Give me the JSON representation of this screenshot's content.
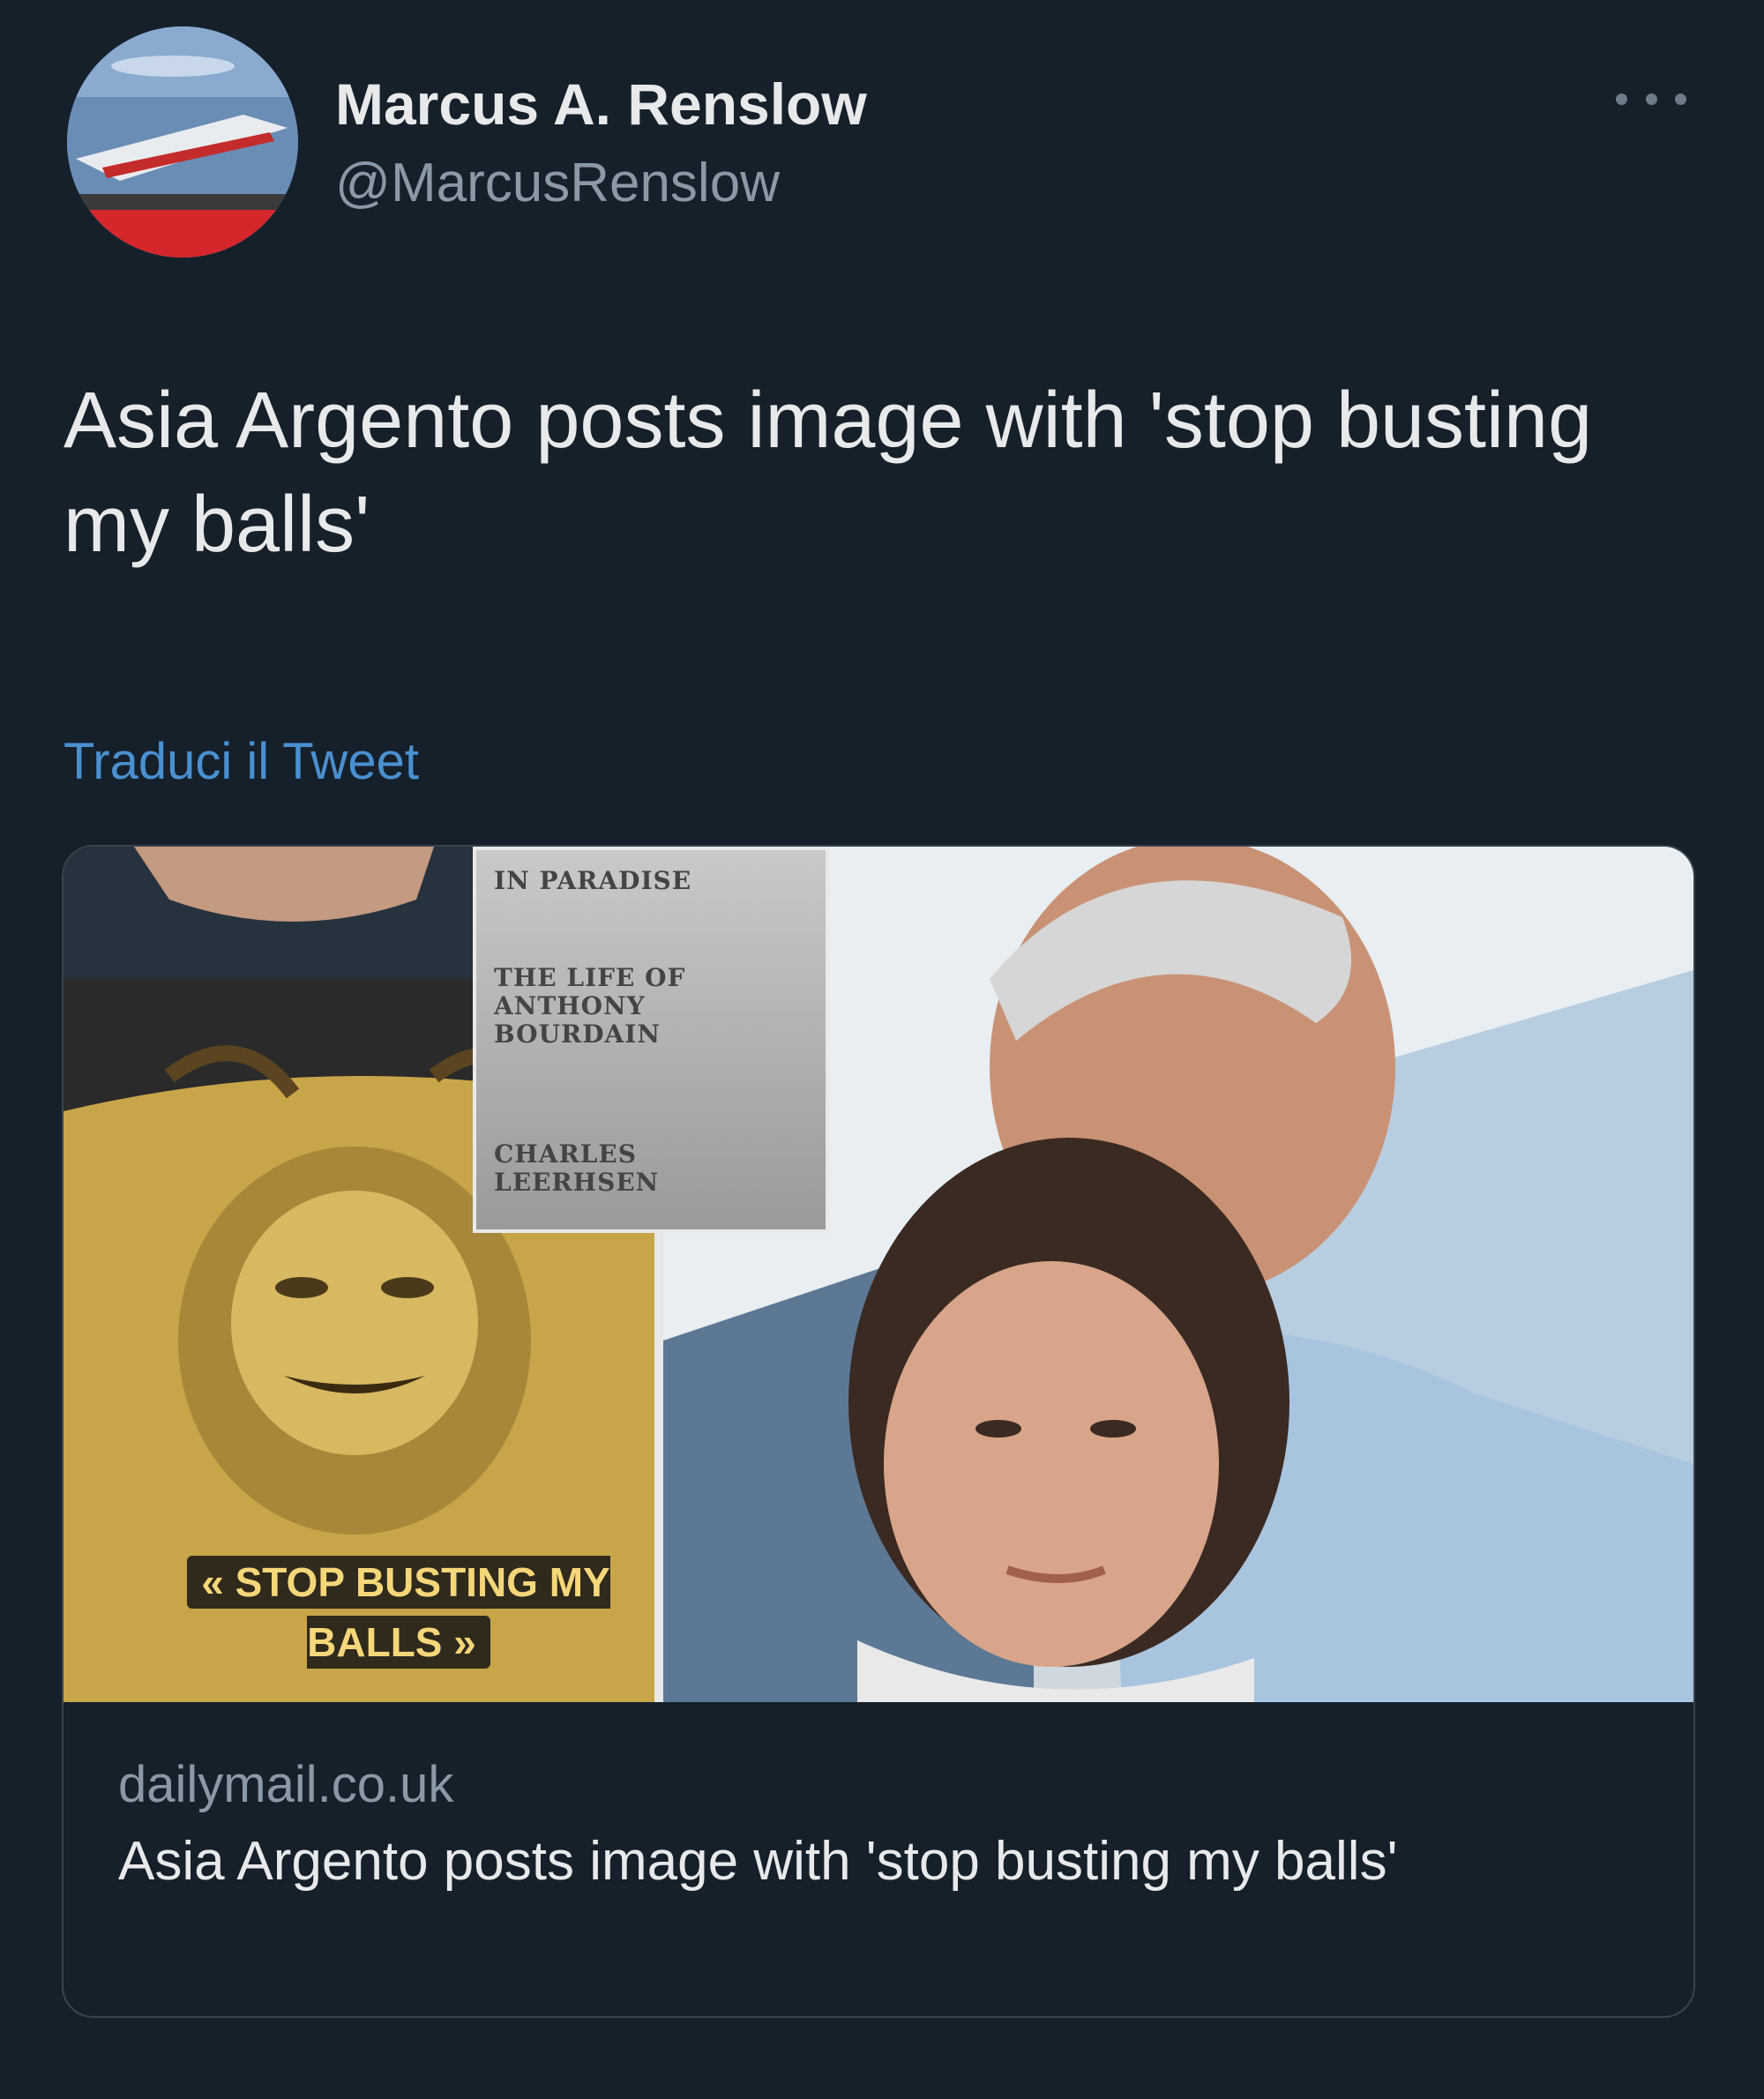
{
  "user": {
    "display_name": "Marcus A. Renslow",
    "handle": "@MarcusRenslow",
    "avatar_icon": "avatar-photo"
  },
  "tweet": {
    "text": "Asia Argento posts image with 'stop busting my balls'",
    "translate_label": "Traduci il Tweet",
    "more_icon": "more-horizontal-icon"
  },
  "card": {
    "image_caption": "« STOP BUSTING MY BALLS »",
    "book": {
      "line1": "IN PARADISE",
      "line2": "THE LIFE OF",
      "line3": "ANTHONY",
      "line4": "BOURDAIN",
      "line5": "CHARLES",
      "line6": "LEERHSEN"
    },
    "domain": "dailymail.co.uk",
    "title": "Asia Argento posts image with 'stop busting my balls'"
  },
  "colors": {
    "background": "#15202b",
    "primary_text": "#e7e9ea",
    "secondary_text": "#8b98a5",
    "link": "#4a90d0",
    "card_border": "#38444d"
  }
}
